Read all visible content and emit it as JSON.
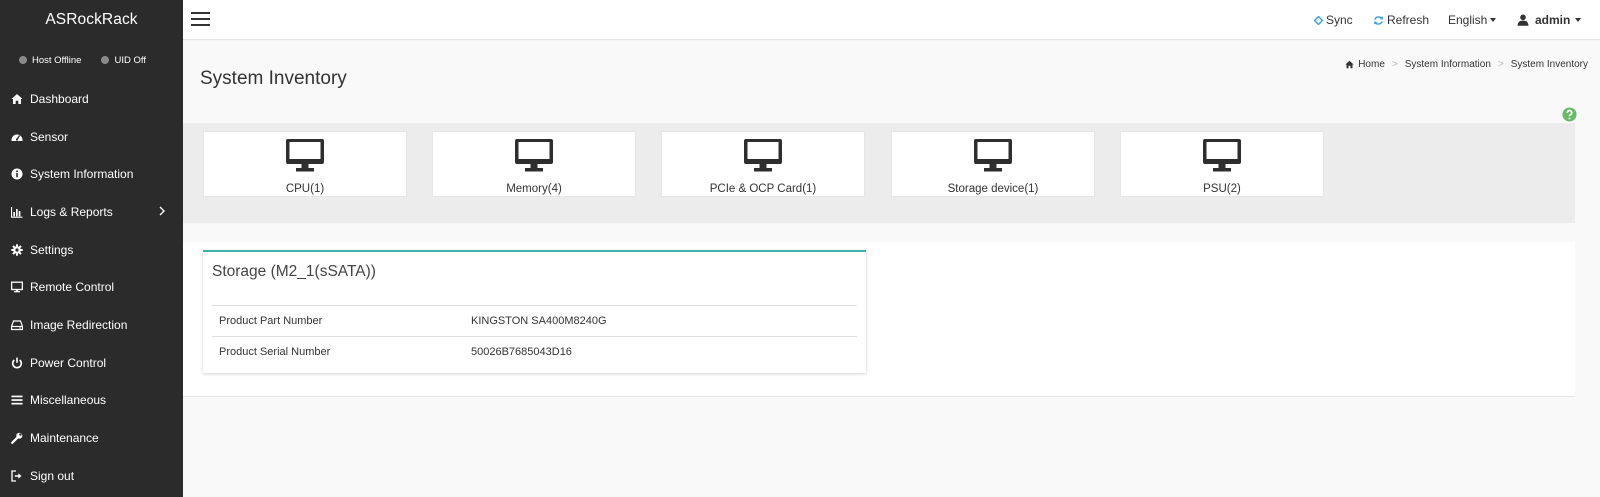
{
  "sidebar": {
    "brand": "ASRockRack",
    "status": [
      {
        "label": "Host Offline",
        "color": "#8a8a8a"
      },
      {
        "label": "UID Off",
        "color": "#8a8a8a"
      }
    ],
    "items": [
      {
        "label": "Dashboard",
        "icon": "home-icon"
      },
      {
        "label": "Sensor",
        "icon": "gauge-icon"
      },
      {
        "label": "System Information",
        "icon": "info-icon"
      },
      {
        "label": "Logs & Reports",
        "icon": "bar-chart-icon",
        "has_submenu": true
      },
      {
        "label": "Settings",
        "icon": "gear-icon"
      },
      {
        "label": "Remote Control",
        "icon": "monitor-icon"
      },
      {
        "label": "Image Redirection",
        "icon": "drive-icon"
      },
      {
        "label": "Power Control",
        "icon": "power-icon"
      },
      {
        "label": "Miscellaneous",
        "icon": "list-icon"
      },
      {
        "label": "Maintenance",
        "icon": "wrench-icon"
      },
      {
        "label": "Sign out",
        "icon": "sign-out-icon"
      }
    ]
  },
  "topbar": {
    "sync_label": "Sync",
    "refresh_label": "Refresh",
    "language": "English",
    "user": "admin",
    "accent_color": "#3aa0d8"
  },
  "page": {
    "title": "System Inventory",
    "breadcrumb": [
      "Home",
      "System Information",
      "System Inventory"
    ]
  },
  "inventory": [
    {
      "label": "CPU(1)",
      "icon": "monitor-icon"
    },
    {
      "label": "Memory(4)",
      "icon": "monitor-icon"
    },
    {
      "label": "PCIe & OCP Card(1)",
      "icon": "monitor-icon"
    },
    {
      "label": "Storage device(1)",
      "icon": "monitor-icon"
    },
    {
      "label": "PSU(2)",
      "icon": "monitor-icon"
    }
  ],
  "storage": {
    "title": "Storage (M2_1(sSATA))",
    "accent_color": "#3bb3a6",
    "rows": [
      {
        "key": "Product Part Number",
        "value": "KINGSTON SA400M8240G"
      },
      {
        "key": "Product Serial Number",
        "value": "50026B7685043D16"
      }
    ]
  }
}
